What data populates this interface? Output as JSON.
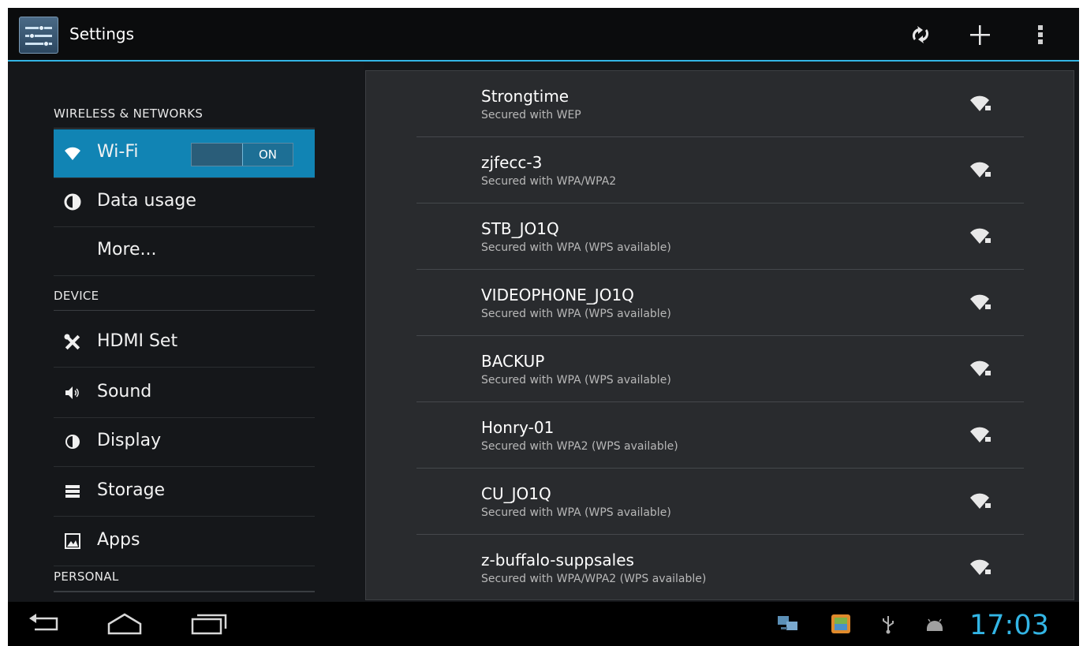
{
  "action_bar": {
    "title": "Settings",
    "icons": [
      "settings-app-icon",
      "wifi-refresh-icon",
      "add-network-icon",
      "overflow-menu-icon"
    ]
  },
  "sidebar": {
    "categories": {
      "wireless": "WIRELESS & NETWORKS",
      "device": "DEVICE",
      "personal": "PERSONAL"
    },
    "items": [
      {
        "label": "Wi-Fi",
        "icon": "wifi-icon",
        "selected": true
      },
      {
        "label": "Data usage",
        "icon": "data-usage-icon"
      },
      {
        "label": "More...",
        "icon": ""
      },
      {
        "label": "HDMI Set",
        "icon": "tools-icon"
      },
      {
        "label": "Sound",
        "icon": "speaker-icon"
      },
      {
        "label": "Display",
        "icon": "brightness-icon"
      },
      {
        "label": "Storage",
        "icon": "storage-icon"
      },
      {
        "label": "Apps",
        "icon": "apps-icon"
      }
    ],
    "wifi_toggle": "ON"
  },
  "networks": [
    {
      "ssid": "Strongtime",
      "security": "Secured with WEP"
    },
    {
      "ssid": "zjfecc-3",
      "security": "Secured with WPA/WPA2"
    },
    {
      "ssid": "STB_JO1Q",
      "security": "Secured with WPA (WPS available)"
    },
    {
      "ssid": "VIDEOPHONE_JO1Q",
      "security": "Secured with WPA (WPS available)"
    },
    {
      "ssid": "BACKUP",
      "security": "Secured with WPA (WPS available)"
    },
    {
      "ssid": "Honry-01",
      "security": "Secured with WPA2 (WPS available)"
    },
    {
      "ssid": "CU_JO1Q",
      "security": "Secured with WPA (WPS available)"
    },
    {
      "ssid": "z-buffalo-suppsales",
      "security": "Secured with WPA/WPA2 (WPS available)"
    }
  ],
  "status_bar": {
    "time": "17:03",
    "tray_icons": [
      "network-icon",
      "gallery-notification-icon",
      "usb-icon",
      "android-debug-icon"
    ]
  },
  "colors": {
    "accent": "#33b5e5",
    "selected_item": "#1184b4",
    "background": "#141619"
  }
}
